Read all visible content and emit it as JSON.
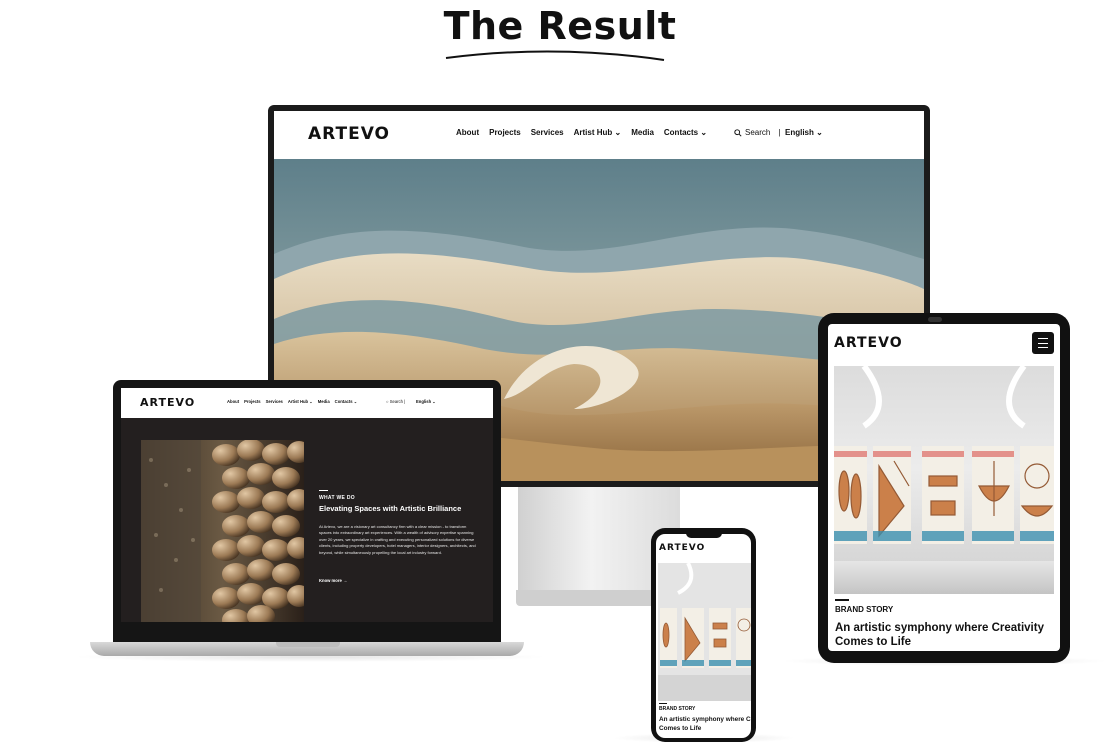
{
  "heading": "The Result",
  "brand": "ARTEVO",
  "nav": {
    "items": [
      "About",
      "Projects",
      "Services",
      "Artist Hub",
      "Media",
      "Contacts"
    ],
    "dropdown_marker": "⌄",
    "search_label": "Search",
    "language": "English"
  },
  "about_section": {
    "eyebrow": "WHAT WE DO",
    "title": "Elevating Spaces with Artistic Brilliance",
    "body": "At Artevo, we are a visionary art consultancy firm with a clear mission - to transform spaces into extraordinary art experiences. With a wealth of advisory expertise spanning over 20 years, we specialize in crafting and executing personalized solutions for diverse clients, including property developers, hotel managers, interior designers, architects, and beyond, while simultaneously propelling the local art industry forward.",
    "link": "Know more"
  },
  "brand_story": {
    "eyebrow": "BRAND STORY",
    "title": "An artistic symphony where Creativity Comes to Life"
  },
  "icons": [
    "search-icon",
    "chevron-down-icon",
    "hamburger-menu-icon",
    "arrow-right-icon"
  ],
  "colors": {
    "dark_section": "#231f1f",
    "device_frame": "#151515",
    "text": "#111111"
  }
}
